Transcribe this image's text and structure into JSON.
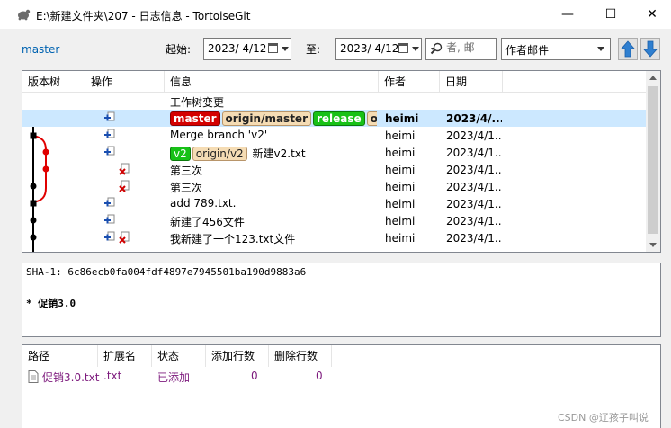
{
  "window": {
    "title": "E:\\新建文件夹\\207 - 日志信息 - TortoiseGit",
    "minimize": "—",
    "maximize": "☐",
    "close": "✕"
  },
  "toolbar": {
    "branch": "master",
    "from_label": "起始:",
    "from_date": "2023/  4/12",
    "to_label": "至:",
    "to_date": "2023/  4/12",
    "search_placeholder": "者, 邮",
    "filter_value": "作者邮件"
  },
  "columns": {
    "graph": "版本树",
    "actions": "操作",
    "message": "信息",
    "author": "作者",
    "date": "日期"
  },
  "commits": [
    {
      "message": "工作树变更",
      "author": "",
      "date": ""
    },
    {
      "message": "",
      "refs": [
        "master",
        "origin/master",
        "release",
        "origin/re"
      ],
      "author": "heimi",
      "date": "2023/4/..."
    },
    {
      "message": "Merge branch 'v2'",
      "author": "heimi",
      "date": "2023/4/1..."
    },
    {
      "message": "新建v2.txt",
      "refs": [
        "v2",
        "origin/v2"
      ],
      "author": "heimi",
      "date": "2023/4/1..."
    },
    {
      "message": "第三次",
      "author": "heimi",
      "date": "2023/4/1..."
    },
    {
      "message": "第三次",
      "author": "heimi",
      "date": "2023/4/1..."
    },
    {
      "message": "add 789.txt.",
      "author": "heimi",
      "date": "2023/4/1..."
    },
    {
      "message": "新建了456文件",
      "author": "heimi",
      "date": "2023/4/1..."
    },
    {
      "message": "我新建了一个123.txt文件",
      "author": "heimi",
      "date": "2023/4/1..."
    }
  ],
  "detail": {
    "sha": "SHA-1: 6c86ecb0fa004fdf4897e7945501ba190d9883a6",
    "message": "* 促销3.0"
  },
  "file_columns": {
    "path": "路径",
    "ext": "扩展名",
    "status": "状态",
    "added": "添加行数",
    "removed": "删除行数"
  },
  "files": [
    {
      "path": "促销3.0.txt",
      "ext": ".txt",
      "status": "已添加",
      "added": "0",
      "removed": "0"
    }
  ],
  "watermark": "CSDN @辽孩子叫说",
  "colors": {
    "selected_row": "#cce8ff",
    "master_tag": "#d40000",
    "release_tag": "#17c117",
    "remote_tag": "#f5dcb4",
    "link": "#0063b1",
    "added_file": "#7d1a7d"
  }
}
